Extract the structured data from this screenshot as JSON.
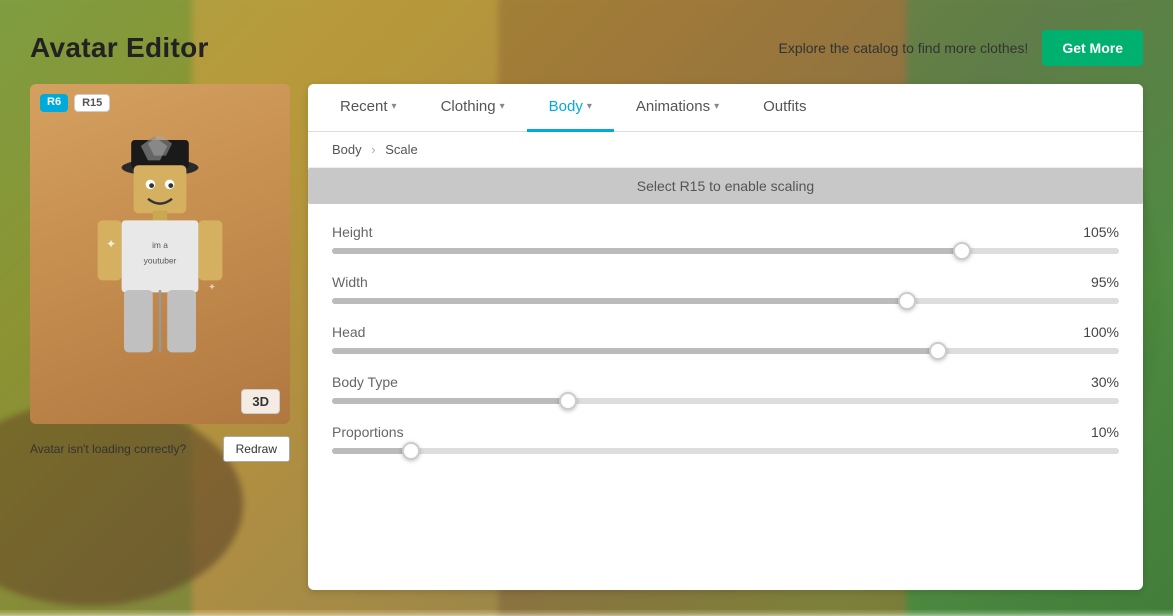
{
  "background": {
    "description": "Blurred outdoor game scene"
  },
  "header": {
    "title": "Avatar Editor",
    "catalog_text": "Explore the catalog to find more clothes!",
    "get_more_label": "Get More"
  },
  "avatar_panel": {
    "badge_r6": "R6",
    "badge_r15": "R15",
    "button_3d": "3D",
    "loading_text": "Avatar isn't loading correctly?",
    "redraw_label": "Redraw"
  },
  "tabs": [
    {
      "id": "recent",
      "label": "Recent",
      "has_chevron": true,
      "active": false
    },
    {
      "id": "clothing",
      "label": "Clothing",
      "has_chevron": true,
      "active": false
    },
    {
      "id": "body",
      "label": "Body",
      "has_chevron": true,
      "active": true
    },
    {
      "id": "animations",
      "label": "Animations",
      "has_chevron": true,
      "active": false
    },
    {
      "id": "outfits",
      "label": "Outfits",
      "has_chevron": false,
      "active": false
    }
  ],
  "breadcrumb": {
    "items": [
      "Body",
      "Scale"
    ]
  },
  "scale_banner": {
    "text": "Select R15 to enable scaling"
  },
  "sliders": [
    {
      "id": "height",
      "label": "Height",
      "value": 105,
      "max": 130,
      "display": "105%"
    },
    {
      "id": "width",
      "label": "Width",
      "value": 95,
      "max": 130,
      "display": "95%"
    },
    {
      "id": "head",
      "label": "Head",
      "value": 100,
      "max": 130,
      "display": "100%"
    },
    {
      "id": "body-type",
      "label": "Body Type",
      "value": 30,
      "max": 100,
      "display": "30%"
    },
    {
      "id": "proportions",
      "label": "Proportions",
      "value": 10,
      "max": 100,
      "display": "10%"
    }
  ],
  "colors": {
    "active_tab": "#00aadd",
    "get_more_bg": "#00b06e",
    "badge_r6_bg": "#00aadd"
  }
}
